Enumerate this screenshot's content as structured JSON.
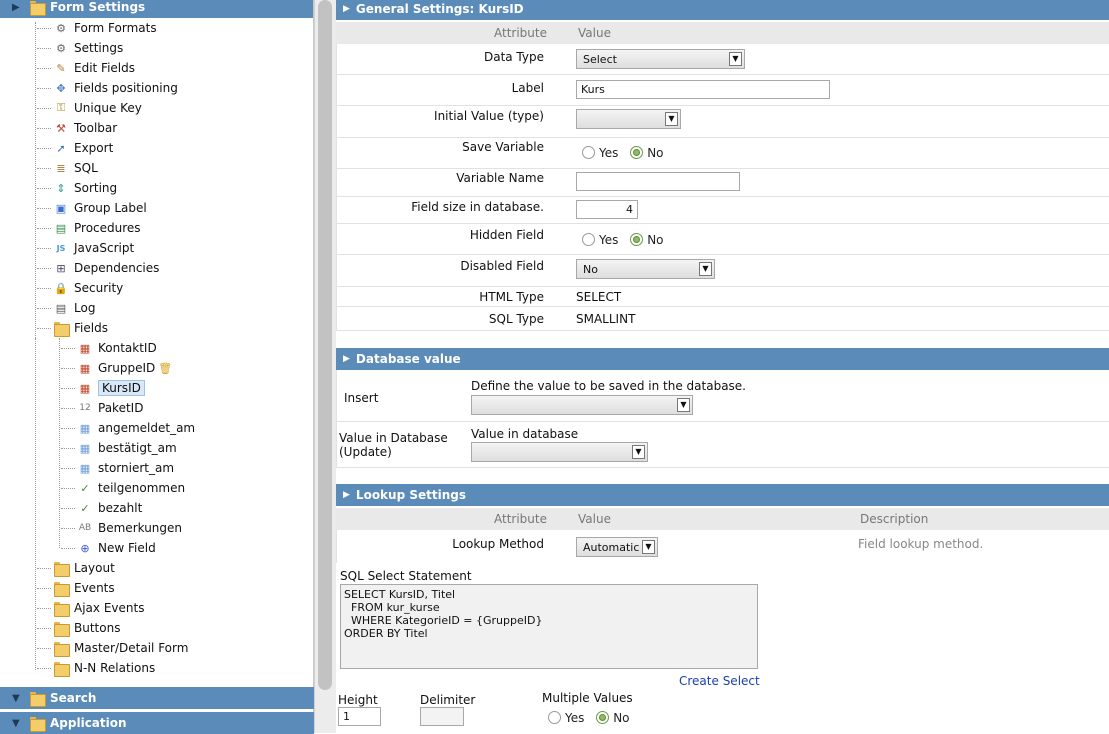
{
  "tree": {
    "top_header": "Form Settings",
    "items": [
      {
        "label": "Form Formats",
        "icon": "gear-icon"
      },
      {
        "label": "Settings",
        "icon": "gear-icon"
      },
      {
        "label": "Edit Fields",
        "icon": "pencil-icon"
      },
      {
        "label": "Fields positioning",
        "icon": "move-icon"
      },
      {
        "label": "Unique Key",
        "icon": "key-icon"
      },
      {
        "label": "Toolbar",
        "icon": "toolbar-icon"
      },
      {
        "label": "Export",
        "icon": "export-icon"
      },
      {
        "label": "SQL",
        "icon": "sql-icon"
      },
      {
        "label": "Sorting",
        "icon": "sort-icon"
      },
      {
        "label": "Group Label",
        "icon": "group-label-icon"
      },
      {
        "label": "Procedures",
        "icon": "procedures-icon"
      },
      {
        "label": "JavaScript",
        "icon": "javascript-icon"
      },
      {
        "label": "Dependencies",
        "icon": "dependencies-icon"
      },
      {
        "label": "Security",
        "icon": "lock-icon"
      },
      {
        "label": "Log",
        "icon": "log-icon"
      },
      {
        "label": "Fields",
        "icon": "folder-icon"
      }
    ],
    "fields": [
      {
        "label": "KontaktID",
        "icon": "select-field-icon"
      },
      {
        "label": "GruppeID",
        "icon": "select-field-icon"
      },
      {
        "label": "KursID",
        "icon": "select-field-icon"
      },
      {
        "label": "PaketID",
        "icon": "number-field-icon",
        "glyph": "12"
      },
      {
        "label": "angemeldet_am",
        "icon": "date-field-icon"
      },
      {
        "label": "bestätigt_am",
        "icon": "date-field-icon"
      },
      {
        "label": "storniert_am",
        "icon": "date-field-icon"
      },
      {
        "label": "teilgenommen",
        "icon": "check-icon"
      },
      {
        "label": "bezahlt",
        "icon": "check-icon"
      },
      {
        "label": "Bemerkungen",
        "icon": "text-field-icon",
        "glyph": "AB"
      },
      {
        "label": "New Field",
        "icon": "plus-circle-icon"
      }
    ],
    "folders": [
      "Layout",
      "Events",
      "Ajax Events",
      "Buttons",
      "Master/Detail Form",
      "N-N Relations"
    ],
    "bottom_headers": [
      "Search",
      "Application"
    ]
  },
  "general": {
    "title": "General Settings: KursID",
    "col_attribute": "Attribute",
    "col_value": "Value",
    "data_type_label": "Data Type",
    "data_type_value": "Select",
    "label_label": "Label",
    "label_value": "Kurs",
    "initial_value_label": "Initial Value (type)",
    "save_variable_label": "Save Variable",
    "yes": "Yes",
    "no": "No",
    "variable_name_label": "Variable Name",
    "field_size_label": "Field size in database.",
    "field_size_value": "4",
    "hidden_field_label": "Hidden Field",
    "disabled_field_label": "Disabled Field",
    "disabled_field_value": "No",
    "html_type_label": "HTML Type",
    "html_type_value": "SELECT",
    "sql_type_label": "SQL Type",
    "sql_type_value": "SMALLINT"
  },
  "dbvalue": {
    "title": "Database value",
    "insert_label": "Insert",
    "insert_desc": "Define the value to be saved in the database.",
    "update_label": "Value in Database (Update)",
    "update_desc": "Value in database"
  },
  "lookup": {
    "title": "Lookup Settings",
    "col_attribute": "Attribute",
    "col_value": "Value",
    "col_description": "Description",
    "method_label": "Lookup Method",
    "method_value": "Automatic",
    "method_desc": "Field lookup method.",
    "sql_label": "SQL Select Statement",
    "sql_text": "SELECT KursID, Titel\n  FROM kur_kurse\n  WHERE KategorieID = {GruppeID}\nORDER BY Titel",
    "create_select": "Create Select",
    "height_label": "Height",
    "height_value": "1",
    "delimiter_label": "Delimiter",
    "multiple_label": "Multiple Values",
    "yes": "Yes",
    "no": "No"
  }
}
